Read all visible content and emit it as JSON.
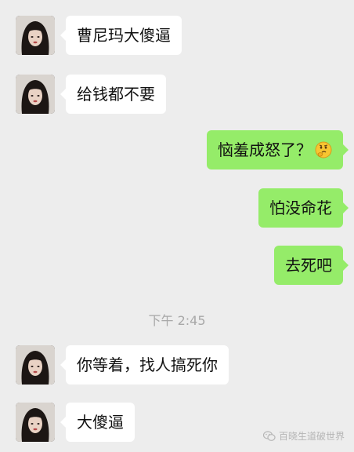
{
  "messages": [
    {
      "side": "left",
      "text": "曹尼玛大傻逼"
    },
    {
      "side": "left",
      "text": "给钱都不要"
    },
    {
      "side": "right",
      "text": "恼羞成怒了？",
      "emoji": "thinking-face-emoji"
    },
    {
      "side": "right",
      "text": "怕没命花"
    },
    {
      "side": "right",
      "text": "去死吧"
    },
    {
      "side": "left",
      "text": "你等着，找人搞死你"
    },
    {
      "side": "left",
      "text": "大傻逼"
    }
  ],
  "timestamp": "下午 2:45",
  "watermark": {
    "text": "百晓生道破世界",
    "icon": "wechat-icon"
  },
  "colors": {
    "background": "#ededed",
    "left_bubble": "#ffffff",
    "right_bubble": "#95ec69",
    "timestamp": "#a8a8a8"
  }
}
